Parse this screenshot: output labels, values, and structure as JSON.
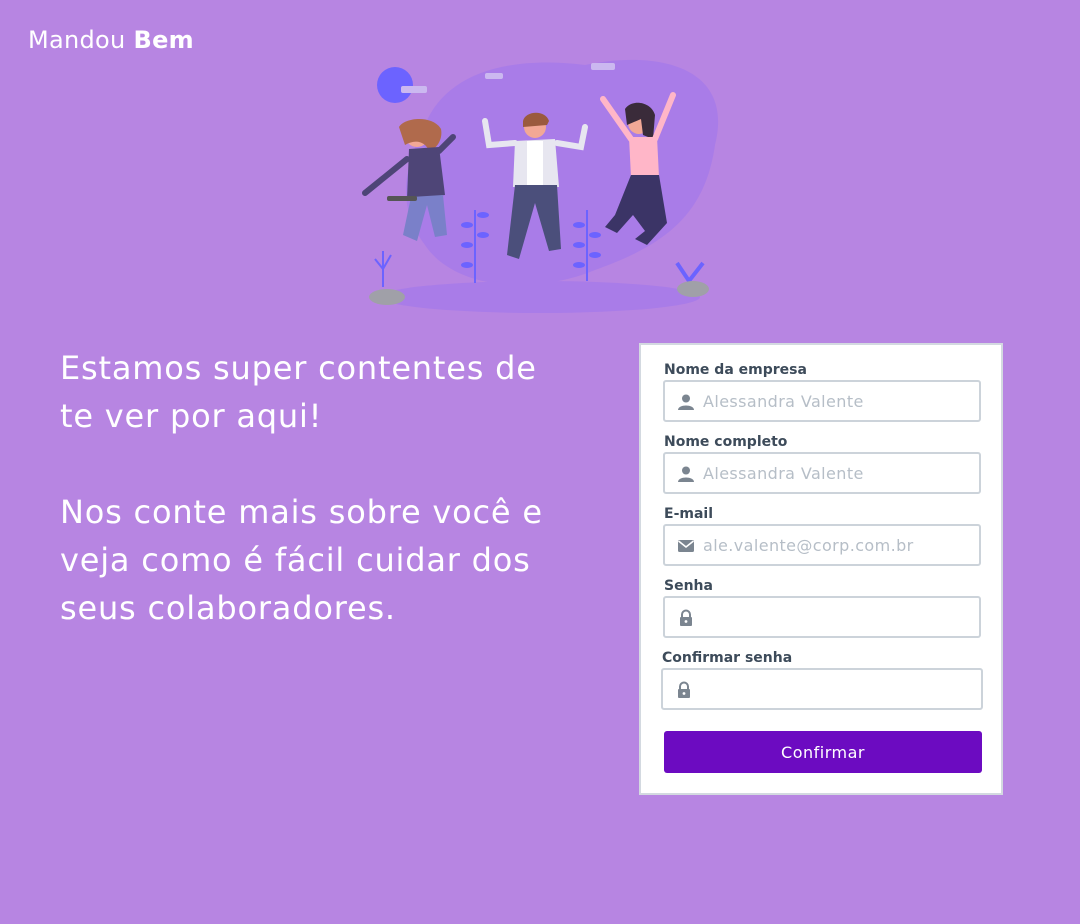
{
  "brand": {
    "name_regular": "Mandou",
    "name_bold": "Bem"
  },
  "welcome": {
    "heading": "Estamos super contentes de te ver por aqui!",
    "body": "Nos conte mais sobre você e veja como é fácil cuidar dos seus colaboradores."
  },
  "form": {
    "company": {
      "label": "Nome da empresa",
      "placeholder": "Alessandra Valente",
      "icon": "user-icon"
    },
    "fullname": {
      "label": "Nome completo",
      "placeholder": "Alessandra Valente",
      "icon": "user-icon"
    },
    "email": {
      "label": "E-mail",
      "placeholder": "ale.valente@corp.com.br",
      "icon": "mail-icon"
    },
    "password": {
      "label": "Senha",
      "placeholder": "",
      "icon": "lock-icon"
    },
    "confirm_password": {
      "label": "Confirmar senha",
      "placeholder": "",
      "icon": "lock-icon"
    },
    "submit_label": "Confirmar"
  },
  "colors": {
    "background": "#b785e2",
    "button": "#6c0bc1",
    "label": "#3d4b5a",
    "illustration_accent": "#6c63ff"
  }
}
